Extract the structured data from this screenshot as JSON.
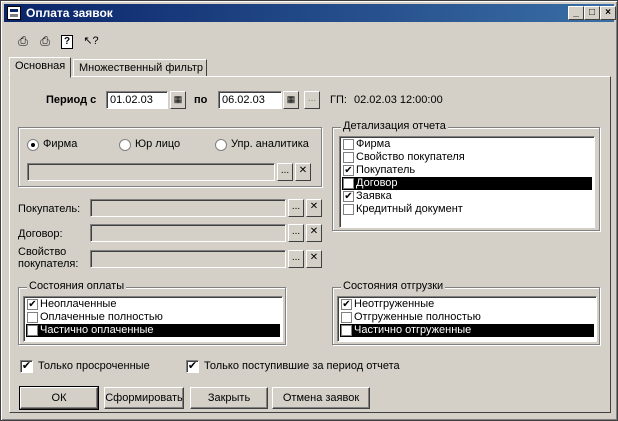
{
  "window": {
    "title": "Оплата заявок",
    "controls": {
      "minimize": "_",
      "maximize": "□",
      "close": "×"
    }
  },
  "toolbar": {
    "icons": [
      "save-settings-icon",
      "restore-settings-icon",
      "help-icon",
      "context-help-icon"
    ],
    "glyphs": {
      "save": "⎙",
      "restore": "⎙",
      "help": "?",
      "context_help": "↖?"
    }
  },
  "tabs": [
    "Основная",
    "Множественный фильтр"
  ],
  "period": {
    "label": "Период с",
    "from": "01.02.03",
    "to_label": "по",
    "to": "06.02.03",
    "gp_label": "ГП:",
    "gp_value": "02.02.03 12:00:00"
  },
  "firm_select": {
    "options": [
      "Фирма",
      "Юр лицо",
      "Упр. аналитика"
    ],
    "selected": "Фирма",
    "value": ""
  },
  "fields": [
    {
      "label": "Покупатель:",
      "value": ""
    },
    {
      "label": "Договор:",
      "value": ""
    },
    {
      "label": "Свойство покупателя:",
      "label_lines": [
        "Свойство",
        "покупателя:"
      ],
      "value": ""
    }
  ],
  "detail": {
    "title": "Детализация отчета",
    "items": [
      {
        "label": "Фирма",
        "checked": false,
        "selected": false
      },
      {
        "label": "Свойство покупателя",
        "checked": false,
        "selected": false
      },
      {
        "label": "Покупатель",
        "checked": true,
        "selected": false
      },
      {
        "label": "Договор",
        "checked": false,
        "selected": true
      },
      {
        "label": "Заявка",
        "checked": true,
        "selected": false
      },
      {
        "label": "Кредитный документ",
        "checked": false,
        "selected": false
      }
    ]
  },
  "payment_states": {
    "title": "Состояния оплаты",
    "items": [
      {
        "label": "Неоплаченные",
        "checked": true,
        "selected": false
      },
      {
        "label": "Оплаченные полностью",
        "checked": false,
        "selected": false
      },
      {
        "label": "Частично оплаченные",
        "checked": false,
        "selected": true
      }
    ]
  },
  "shipment_states": {
    "title": "Состояния отгрузки",
    "items": [
      {
        "label": "Неотгруженные",
        "checked": true,
        "selected": false
      },
      {
        "label": "Отгруженные полностью",
        "checked": false,
        "selected": false
      },
      {
        "label": "Частично отгруженные",
        "checked": false,
        "selected": true
      }
    ]
  },
  "options": {
    "only_overdue": {
      "label": "Только просроченные",
      "checked": true
    },
    "only_received": {
      "label": "Только поступившие за период отчета",
      "checked": true
    }
  },
  "buttons": {
    "ok": "ОК",
    "form": "Сформировать",
    "close": "Закрыть",
    "cancel_requests": "Отмена заявок"
  },
  "glyphs": {
    "check": "✔",
    "ellipsis": "...",
    "clear": "✕",
    "calendar": "▦"
  }
}
